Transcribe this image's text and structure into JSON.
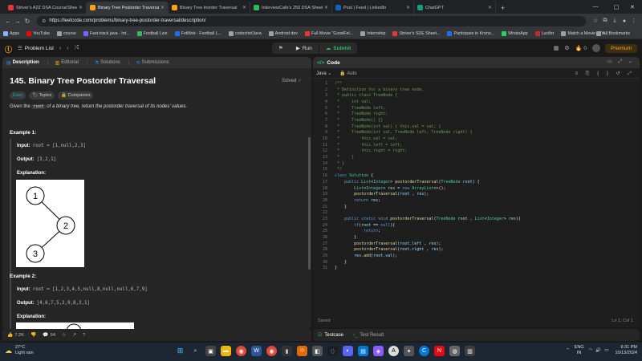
{
  "browser": {
    "tabs": [
      {
        "title": "Striver's A2Z DSA Course/Sheet",
        "color": "#e53935"
      },
      {
        "title": "Binary Tree Postorder Traversal",
        "color": "#ffa116",
        "active": true
      },
      {
        "title": "Binary Tree Inorder Traversal",
        "color": "#ffa116"
      },
      {
        "title": "InterviewCafe's 250 DSA Sheet",
        "color": "#2cbb5d"
      },
      {
        "title": "Post | Feed | LinkedIn",
        "color": "#0a66c2"
      },
      {
        "title": "ChatGPT",
        "color": "#10a37f"
      }
    ],
    "url": "https://leetcode.com/problems/binary-tree-postorder-traversal/description/",
    "bookmarks": [
      {
        "label": "Apps",
        "color": "#8ab4f8"
      },
      {
        "label": "YouTube",
        "color": "#ff0000"
      },
      {
        "label": "course",
        "color": "#9aa0a6"
      },
      {
        "label": "Fast-track java - Int...",
        "color": "#7b61ff"
      },
      {
        "label": "Football Live",
        "color": "#2cbb5d"
      },
      {
        "label": "FotMob - Football L...",
        "color": "#1a73e8"
      },
      {
        "label": "codechefJava",
        "color": "#9aa0a6"
      },
      {
        "label": "Android dev",
        "color": "#9aa0a6"
      },
      {
        "label": "Full Movie \"GoodFel...",
        "color": "#e53935"
      },
      {
        "label": "Internship",
        "color": "#9aa0a6"
      },
      {
        "label": "Striver's SDE Sheet...",
        "color": "#e53935"
      },
      {
        "label": "Participate in Krono...",
        "color": "#1a73e8"
      },
      {
        "label": "WhatsApp",
        "color": "#25d366"
      },
      {
        "label": "Lucifer",
        "color": "#c62828"
      },
      {
        "label": "Match a Movie - Th...",
        "color": "#9aa0a6"
      }
    ],
    "all_bookmarks": "All Bookmarks"
  },
  "header": {
    "problem_list": "Problem List",
    "run": "Run",
    "submit": "Submit",
    "notifications": "0",
    "premium": "Premium"
  },
  "left": {
    "tabs": [
      "Description",
      "Editorial",
      "Solutions",
      "Submissions"
    ],
    "title": "145. Binary Tree Postorder Traversal",
    "solved": "Solved",
    "chips": [
      "Easy",
      "Topics",
      "Companies"
    ],
    "desc_pre": "Given the ",
    "desc_code": "root",
    "desc_post": " of a binary tree, return the postorder traversal of its nodes' values.",
    "example1": {
      "heading": "Example 1:",
      "input_label": "Input:",
      "input": "root = [1,null,2,3]",
      "output_label": "Output:",
      "output": "[3,2,1]",
      "explanation_label": "Explanation:",
      "nodes": [
        "1",
        "2",
        "3"
      ]
    },
    "example2": {
      "heading": "Example 2:",
      "input_label": "Input:",
      "input": "root = [1,2,3,4,5,null,8,null,null,6,7,9]",
      "output_label": "Output:",
      "output": "[4,6,7,5,2,9,8,3,1]",
      "explanation_label": "Explanation:"
    },
    "footer": {
      "likes": "7.2K",
      "comments": "94"
    }
  },
  "right": {
    "title": "Code",
    "language": "Java",
    "auto": "Auto",
    "code_lines": [
      [
        [
          "cm",
          "/**"
        ]
      ],
      [
        [
          "cm",
          " * Definition for a binary tree node."
        ]
      ],
      [
        [
          "cm",
          " * public class TreeNode {"
        ]
      ],
      [
        [
          "cm",
          " *     int val;"
        ]
      ],
      [
        [
          "cm",
          " *     TreeNode left;"
        ]
      ],
      [
        [
          "cm",
          " *     TreeNode right;"
        ]
      ],
      [
        [
          "cm",
          " *     TreeNode() {}"
        ]
      ],
      [
        [
          "cm",
          " *     TreeNode(int val) { this.val = val; }"
        ]
      ],
      [
        [
          "cm",
          " *     TreeNode(int val, TreeNode left, TreeNode right) {"
        ]
      ],
      [
        [
          "cm",
          " *         this.val = val;"
        ]
      ],
      [
        [
          "cm",
          " *         this.left = left;"
        ]
      ],
      [
        [
          "cm",
          " *         this.right = right;"
        ]
      ],
      [
        [
          "cm",
          " *     }"
        ]
      ],
      [
        [
          "cm",
          " * }"
        ]
      ],
      [
        [
          "cm",
          " */"
        ]
      ],
      [
        [
          "kw",
          "class "
        ],
        [
          "ty",
          "Solution"
        ],
        [
          "ctext",
          " {"
        ]
      ],
      [
        [
          "kw",
          "    public "
        ],
        [
          "ty",
          "List"
        ],
        [
          "ctext",
          "<"
        ],
        [
          "ty",
          "Integer"
        ],
        [
          "ctext",
          "> "
        ],
        [
          "fn",
          "postorderTraversal"
        ],
        [
          "ctext",
          "("
        ],
        [
          "ty",
          "TreeNode"
        ],
        [
          "vr",
          " root"
        ],
        [
          "ctext",
          ") {"
        ]
      ],
      [
        [
          "ty",
          "        List"
        ],
        [
          "ctext",
          "<"
        ],
        [
          "ty",
          "Integer"
        ],
        [
          "ctext",
          "> "
        ],
        [
          "vr",
          "res"
        ],
        [
          "ctext",
          " = "
        ],
        [
          "kw",
          "new "
        ],
        [
          "ty",
          "ArrayList"
        ],
        [
          "ctext",
          "<>();"
        ]
      ],
      [
        [
          "fn",
          "        postorderTraversal"
        ],
        [
          "ctext",
          "("
        ],
        [
          "vr",
          "root"
        ],
        [
          "ctext",
          " , "
        ],
        [
          "vr",
          "res"
        ],
        [
          "ctext",
          ");"
        ]
      ],
      [
        [
          "kw",
          "        return "
        ],
        [
          "vr",
          "res"
        ],
        [
          "ctext",
          ";"
        ]
      ],
      [
        [
          "ctext",
          "    }"
        ]
      ],
      [
        [
          "ctext",
          ""
        ]
      ],
      [
        [
          "kw",
          "    public static void "
        ],
        [
          "fn",
          "postorderTraversal"
        ],
        [
          "ctext",
          "("
        ],
        [
          "ty",
          "TreeNode"
        ],
        [
          "vr",
          " root"
        ],
        [
          "ctext",
          " , "
        ],
        [
          "ty",
          "List"
        ],
        [
          "ctext",
          "<"
        ],
        [
          "ty",
          "Integer"
        ],
        [
          "ctext",
          "> "
        ],
        [
          "vr",
          "res"
        ],
        [
          "ctext",
          "){"
        ]
      ],
      [
        [
          "kw",
          "        if"
        ],
        [
          "ctext",
          "("
        ],
        [
          "vr",
          "root"
        ],
        [
          "ctext",
          " == "
        ],
        [
          "kw",
          "null"
        ],
        [
          "ctext",
          "){"
        ]
      ],
      [
        [
          "kw",
          "            return"
        ],
        [
          "ctext",
          ";"
        ]
      ],
      [
        [
          "ctext",
          "        }"
        ]
      ],
      [
        [
          "fn",
          "        postorderTraversal"
        ],
        [
          "ctext",
          "("
        ],
        [
          "vr",
          "root"
        ],
        [
          "ctext",
          "."
        ],
        [
          "vr",
          "left"
        ],
        [
          "ctext",
          " , "
        ],
        [
          "vr",
          "res"
        ],
        [
          "ctext",
          ");"
        ]
      ],
      [
        [
          "fn",
          "        postorderTraversal"
        ],
        [
          "ctext",
          "("
        ],
        [
          "vr",
          "root"
        ],
        [
          "ctext",
          "."
        ],
        [
          "vr",
          "right"
        ],
        [
          "ctext",
          " , "
        ],
        [
          "vr",
          "res"
        ],
        [
          "ctext",
          ");"
        ]
      ],
      [
        [
          "vr",
          "        res"
        ],
        [
          "ctext",
          "."
        ],
        [
          "fn",
          "add"
        ],
        [
          "ctext",
          "("
        ],
        [
          "vr",
          "root"
        ],
        [
          "ctext",
          "."
        ],
        [
          "vr",
          "val"
        ],
        [
          "ctext",
          ");"
        ]
      ],
      [
        [
          "ctext",
          "    }"
        ]
      ],
      [
        [
          "ctext",
          "}"
        ]
      ]
    ],
    "status": "Saved",
    "cursor": "Ln 1, Col 1",
    "bottom_tabs": [
      "Testcase",
      "Test Result"
    ]
  },
  "taskbar": {
    "temp": "27°C",
    "weather": "Light rain",
    "lang1": "ENG",
    "lang2": "IN",
    "time": "6:31 PM",
    "date": "10/13/2024"
  }
}
